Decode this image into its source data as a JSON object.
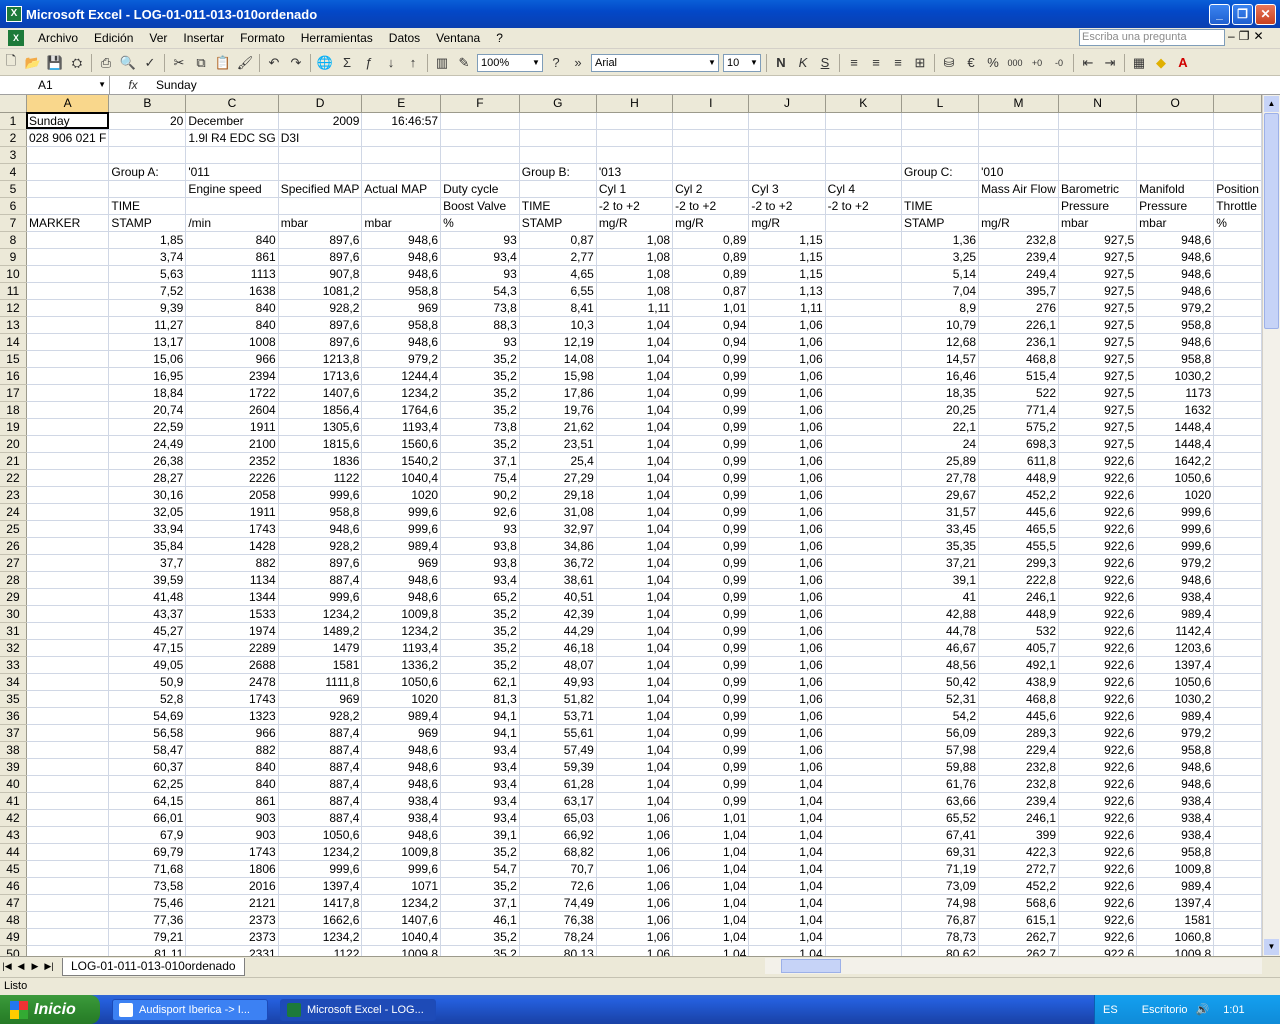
{
  "window": {
    "title": "Microsoft Excel - LOG-01-011-013-010ordenado"
  },
  "menu": {
    "items": [
      "Archivo",
      "Edición",
      "Ver",
      "Insertar",
      "Formato",
      "Herramientas",
      "Datos",
      "Ventana",
      "?"
    ],
    "ask_placeholder": "Escriba una pregunta"
  },
  "toolbar": {
    "zoom": "100%",
    "font": "Arial",
    "size": "10"
  },
  "formula": {
    "namebox": "A1",
    "fx": "fx",
    "value": "Sunday"
  },
  "columns": [
    "A",
    "B",
    "C",
    "D",
    "E",
    "F",
    "G",
    "H",
    "I",
    "J",
    "K",
    "L",
    "M",
    "N",
    "O",
    ""
  ],
  "header_rows": [
    [
      "Sunday",
      "20",
      "December",
      "2009",
      "16:46:57",
      "",
      "",
      "",
      "",
      "",
      "",
      "",
      "",
      "",
      "",
      ""
    ],
    [
      "028 906 021 F",
      "",
      "1.9l R4 EDC SG",
      "D3I",
      "",
      "",
      "",
      "",
      "",
      "",
      "",
      "",
      "",
      "",
      "",
      ""
    ],
    [
      "",
      "",
      "",
      "",
      "",
      "",
      "",
      "",
      "",
      "",
      "",
      "",
      "",
      "",
      "",
      ""
    ],
    [
      "",
      "Group A:",
      "'011",
      "",
      "",
      "",
      "Group B:",
      "'013",
      "",
      "",
      "",
      "Group C:",
      "'010",
      "",
      "",
      ""
    ],
    [
      "",
      "",
      "Engine speed",
      "Specified MAP",
      "Actual MAP",
      "Duty cycle",
      "",
      "Cyl 1",
      "Cyl 2",
      "Cyl 3",
      "Cyl 4",
      "",
      "Mass Air Flow",
      "Barometric",
      "Manifold",
      "Position"
    ],
    [
      "",
      "TIME",
      "",
      "",
      "",
      "Boost Valve",
      "TIME",
      "-2 to +2",
      "-2 to +2",
      "-2 to +2",
      "-2 to +2",
      "TIME",
      "",
      "Pressure",
      "Pressure",
      "Throttle"
    ],
    [
      "MARKER",
      "STAMP",
      "/min",
      "mbar",
      "mbar",
      "%",
      "STAMP",
      "mg/R",
      "mg/R",
      "mg/R",
      "",
      "STAMP",
      "mg/R",
      "mbar",
      "mbar",
      "%"
    ]
  ],
  "data_rows": [
    [
      "1,85",
      "840",
      "897,6",
      "948,6",
      "93",
      "0,87",
      "1,08",
      "0,89",
      "1,15",
      "1,36",
      "232,8",
      "927,5",
      "948,6"
    ],
    [
      "3,74",
      "861",
      "897,6",
      "948,6",
      "93,4",
      "2,77",
      "1,08",
      "0,89",
      "1,15",
      "3,25",
      "239,4",
      "927,5",
      "948,6"
    ],
    [
      "5,63",
      "1113",
      "907,8",
      "948,6",
      "93",
      "4,65",
      "1,08",
      "0,89",
      "1,15",
      "5,14",
      "249,4",
      "927,5",
      "948,6"
    ],
    [
      "7,52",
      "1638",
      "1081,2",
      "958,8",
      "54,3",
      "6,55",
      "1,08",
      "0,87",
      "1,13",
      "7,04",
      "395,7",
      "927,5",
      "948,6"
    ],
    [
      "9,39",
      "840",
      "928,2",
      "969",
      "73,8",
      "8,41",
      "1,11",
      "1,01",
      "1,11",
      "8,9",
      "276",
      "927,5",
      "979,2"
    ],
    [
      "11,27",
      "840",
      "897,6",
      "958,8",
      "88,3",
      "10,3",
      "1,04",
      "0,94",
      "1,06",
      "10,79",
      "226,1",
      "927,5",
      "958,8"
    ],
    [
      "13,17",
      "1008",
      "897,6",
      "948,6",
      "93",
      "12,19",
      "1,04",
      "0,94",
      "1,06",
      "12,68",
      "236,1",
      "927,5",
      "948,6"
    ],
    [
      "15,06",
      "966",
      "1213,8",
      "979,2",
      "35,2",
      "14,08",
      "1,04",
      "0,99",
      "1,06",
      "14,57",
      "468,8",
      "927,5",
      "958,8"
    ],
    [
      "16,95",
      "2394",
      "1713,6",
      "1244,4",
      "35,2",
      "15,98",
      "1,04",
      "0,99",
      "1,06",
      "16,46",
      "515,4",
      "927,5",
      "1030,2"
    ],
    [
      "18,84",
      "1722",
      "1407,6",
      "1234,2",
      "35,2",
      "17,86",
      "1,04",
      "0,99",
      "1,06",
      "18,35",
      "522",
      "927,5",
      "1173"
    ],
    [
      "20,74",
      "2604",
      "1856,4",
      "1764,6",
      "35,2",
      "19,76",
      "1,04",
      "0,99",
      "1,06",
      "20,25",
      "771,4",
      "927,5",
      "1632"
    ],
    [
      "22,59",
      "1911",
      "1305,6",
      "1193,4",
      "73,8",
      "21,62",
      "1,04",
      "0,99",
      "1,06",
      "22,1",
      "575,2",
      "927,5",
      "1448,4"
    ],
    [
      "24,49",
      "2100",
      "1815,6",
      "1560,6",
      "35,2",
      "23,51",
      "1,04",
      "0,99",
      "1,06",
      "24",
      "698,3",
      "927,5",
      "1448,4"
    ],
    [
      "26,38",
      "2352",
      "1836",
      "1540,2",
      "37,1",
      "25,4",
      "1,04",
      "0,99",
      "1,06",
      "25,89",
      "611,8",
      "922,6",
      "1642,2"
    ],
    [
      "28,27",
      "2226",
      "1122",
      "1040,4",
      "75,4",
      "27,29",
      "1,04",
      "0,99",
      "1,06",
      "27,78",
      "448,9",
      "922,6",
      "1050,6"
    ],
    [
      "30,16",
      "2058",
      "999,6",
      "1020",
      "90,2",
      "29,18",
      "1,04",
      "0,99",
      "1,06",
      "29,67",
      "452,2",
      "922,6",
      "1020"
    ],
    [
      "32,05",
      "1911",
      "958,8",
      "999,6",
      "92,6",
      "31,08",
      "1,04",
      "0,99",
      "1,06",
      "31,57",
      "445,6",
      "922,6",
      "999,6"
    ],
    [
      "33,94",
      "1743",
      "948,6",
      "999,6",
      "93",
      "32,97",
      "1,04",
      "0,99",
      "1,06",
      "33,45",
      "465,5",
      "922,6",
      "999,6"
    ],
    [
      "35,84",
      "1428",
      "928,2",
      "989,4",
      "93,8",
      "34,86",
      "1,04",
      "0,99",
      "1,06",
      "35,35",
      "455,5",
      "922,6",
      "999,6"
    ],
    [
      "37,7",
      "882",
      "897,6",
      "969",
      "93,8",
      "36,72",
      "1,04",
      "0,99",
      "1,06",
      "37,21",
      "299,3",
      "922,6",
      "979,2"
    ],
    [
      "39,59",
      "1134",
      "887,4",
      "948,6",
      "93,4",
      "38,61",
      "1,04",
      "0,99",
      "1,06",
      "39,1",
      "222,8",
      "922,6",
      "948,6"
    ],
    [
      "41,48",
      "1344",
      "999,6",
      "948,6",
      "65,2",
      "40,51",
      "1,04",
      "0,99",
      "1,06",
      "41",
      "246,1",
      "922,6",
      "938,4"
    ],
    [
      "43,37",
      "1533",
      "1234,2",
      "1009,8",
      "35,2",
      "42,39",
      "1,04",
      "0,99",
      "1,06",
      "42,88",
      "448,9",
      "922,6",
      "989,4"
    ],
    [
      "45,27",
      "1974",
      "1489,2",
      "1234,2",
      "35,2",
      "44,29",
      "1,04",
      "0,99",
      "1,06",
      "44,78",
      "532",
      "922,6",
      "1142,4"
    ],
    [
      "47,15",
      "2289",
      "1479",
      "1193,4",
      "35,2",
      "46,18",
      "1,04",
      "0,99",
      "1,06",
      "46,67",
      "405,7",
      "922,6",
      "1203,6"
    ],
    [
      "49,05",
      "2688",
      "1581",
      "1336,2",
      "35,2",
      "48,07",
      "1,04",
      "0,99",
      "1,06",
      "48,56",
      "492,1",
      "922,6",
      "1397,4"
    ],
    [
      "50,9",
      "2478",
      "1111,8",
      "1050,6",
      "62,1",
      "49,93",
      "1,04",
      "0,99",
      "1,06",
      "50,42",
      "438,9",
      "922,6",
      "1050,6"
    ],
    [
      "52,8",
      "1743",
      "969",
      "1020",
      "81,3",
      "51,82",
      "1,04",
      "0,99",
      "1,06",
      "52,31",
      "468,8",
      "922,6",
      "1030,2"
    ],
    [
      "54,69",
      "1323",
      "928,2",
      "989,4",
      "94,1",
      "53,71",
      "1,04",
      "0,99",
      "1,06",
      "54,2",
      "445,6",
      "922,6",
      "989,4"
    ],
    [
      "56,58",
      "966",
      "887,4",
      "969",
      "94,1",
      "55,61",
      "1,04",
      "0,99",
      "1,06",
      "56,09",
      "289,3",
      "922,6",
      "979,2"
    ],
    [
      "58,47",
      "882",
      "887,4",
      "948,6",
      "93,4",
      "57,49",
      "1,04",
      "0,99",
      "1,06",
      "57,98",
      "229,4",
      "922,6",
      "958,8"
    ],
    [
      "60,37",
      "840",
      "887,4",
      "948,6",
      "93,4",
      "59,39",
      "1,04",
      "0,99",
      "1,06",
      "59,88",
      "232,8",
      "922,6",
      "948,6"
    ],
    [
      "62,25",
      "840",
      "887,4",
      "948,6",
      "93,4",
      "61,28",
      "1,04",
      "0,99",
      "1,04",
      "61,76",
      "232,8",
      "922,6",
      "948,6"
    ],
    [
      "64,15",
      "861",
      "887,4",
      "938,4",
      "93,4",
      "63,17",
      "1,04",
      "0,99",
      "1,04",
      "63,66",
      "239,4",
      "922,6",
      "938,4"
    ],
    [
      "66,01",
      "903",
      "887,4",
      "938,4",
      "93,4",
      "65,03",
      "1,06",
      "1,01",
      "1,04",
      "65,52",
      "246,1",
      "922,6",
      "938,4"
    ],
    [
      "67,9",
      "903",
      "1050,6",
      "948,6",
      "39,1",
      "66,92",
      "1,06",
      "1,04",
      "1,04",
      "67,41",
      "399",
      "922,6",
      "938,4"
    ],
    [
      "69,79",
      "1743",
      "1234,2",
      "1009,8",
      "35,2",
      "68,82",
      "1,06",
      "1,04",
      "1,04",
      "69,31",
      "422,3",
      "922,6",
      "958,8"
    ],
    [
      "71,68",
      "1806",
      "999,6",
      "999,6",
      "54,7",
      "70,7",
      "1,06",
      "1,04",
      "1,04",
      "71,19",
      "272,7",
      "922,6",
      "1009,8"
    ],
    [
      "73,58",
      "2016",
      "1397,4",
      "1071",
      "35,2",
      "72,6",
      "1,06",
      "1,04",
      "1,04",
      "73,09",
      "452,2",
      "922,6",
      "989,4"
    ],
    [
      "75,46",
      "2121",
      "1417,8",
      "1234,2",
      "37,1",
      "74,49",
      "1,06",
      "1,04",
      "1,04",
      "74,98",
      "568,6",
      "922,6",
      "1397,4"
    ],
    [
      "77,36",
      "2373",
      "1662,6",
      "1407,6",
      "46,1",
      "76,38",
      "1,06",
      "1,04",
      "1,04",
      "76,87",
      "615,1",
      "922,6",
      "1581"
    ],
    [
      "79,21",
      "2373",
      "1234,2",
      "1040,4",
      "35,2",
      "78,24",
      "1,06",
      "1,04",
      "1,04",
      "78,73",
      "262,7",
      "922,6",
      "1060,8"
    ],
    [
      "81,11",
      "2331",
      "1122",
      "1009,8",
      "35,2",
      "80,13",
      "1,06",
      "1,04",
      "1,04",
      "80,62",
      "262,7",
      "922,6",
      "1009,8"
    ]
  ],
  "sheet": {
    "tab": "LOG-01-011-013-010ordenado"
  },
  "status": {
    "text": "Listo"
  },
  "taskbar": {
    "start": "Inicio",
    "tasks": [
      "Audisport Iberica -> I...",
      "Microsoft Excel - LOG..."
    ],
    "lang": "ES",
    "desk": "Escritorio",
    "clock": "1:01"
  }
}
